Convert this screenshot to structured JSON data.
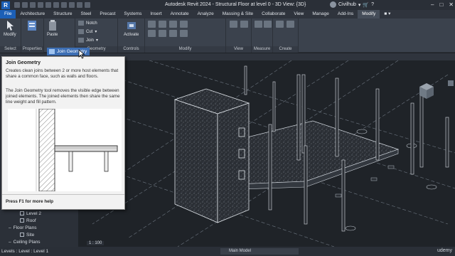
{
  "app": {
    "logo_letter": "R",
    "window_title": "Autodesk Revit 2024 - Structural Floor at level 0 - 3D View: {3D}",
    "user": "Civilhub"
  },
  "tabs": [
    "File",
    "Architecture",
    "Structure",
    "Steel",
    "Precast",
    "Systems",
    "Insert",
    "Annotate",
    "Analyze",
    "Massing & Site",
    "Collaborate",
    "View",
    "Manage",
    "Add-Ins",
    "Modify"
  ],
  "active_tab": "Modify",
  "ribbon": {
    "select": {
      "button": "Modify",
      "label": "Select"
    },
    "properties": {
      "label": "Properties"
    },
    "clipboard": {
      "paste": "Paste"
    },
    "geometry": {
      "notch": "Notch",
      "cut": "Cut",
      "join": "Join",
      "label": "Geometry"
    },
    "controls": {
      "activate": "Activate",
      "label": "Controls"
    },
    "modify": {
      "label": "Modify"
    },
    "view": {
      "label": "View"
    },
    "measure": {
      "label": "Measure"
    },
    "create": {
      "label": "Create"
    }
  },
  "tooltip": {
    "anchor_label": "Join Geometry",
    "title": "Join Geometry",
    "description": "Creates clean joins between 2 or more host elements that share a common face, such as walls and floors.",
    "body": "The Join Geometry tool removes the visible edge between joined elements. The joined elements then share the same line weight and fill pattern.",
    "help": "Press F1 for more help"
  },
  "project_browser": {
    "items": [
      {
        "label": "Level 2",
        "kind": "view"
      },
      {
        "label": "Roof",
        "kind": "view"
      },
      {
        "label": "Floor Plans",
        "kind": "group"
      },
      {
        "label": "Site",
        "kind": "view"
      },
      {
        "label": "Ceiling Plans",
        "kind": "group"
      }
    ]
  },
  "viewport": {
    "scale": "1 : 100",
    "viewcube_face": "TOP"
  },
  "statusbar": {
    "text": "Levels : Level : Level 1",
    "model": "Main Model",
    "watermark": "udemy"
  }
}
